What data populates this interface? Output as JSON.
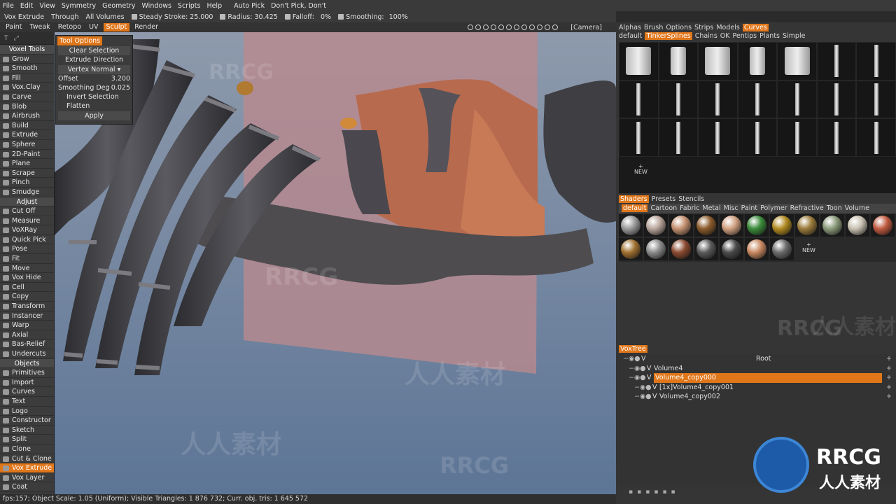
{
  "menu": {
    "items": [
      "File",
      "Edit",
      "View",
      "Symmetry",
      "Geometry",
      "Windows",
      "Scripts",
      "Help"
    ],
    "auto_pick": "Auto Pick",
    "dont_pick": "Don't  Pick,  Don't"
  },
  "toolstrip": {
    "tool": "Vox Extrude",
    "through": "Through",
    "all_volumes": "All  Volumes",
    "stroke": "Steady  Stroke: 25.000",
    "radius": "Radius: 30.425",
    "falloff": "Falloff:",
    "falloff_value": "0%",
    "smoothing": "Smoothing:",
    "smoothing_value": "100%"
  },
  "rooms": {
    "tabs": [
      "Paint",
      "Tweak",
      "Retopo",
      "UV",
      "Sculpt",
      "Render"
    ],
    "active": "Sculpt",
    "camera": "[Camera]"
  },
  "tool_options": {
    "title": "Tool  Options",
    "clear_selection": "Clear  Selection",
    "extrude_direction": "Extrude  Direction",
    "vertex_normal": "Vertex  Normal",
    "offset_label": "Offset",
    "offset_value": "3.200",
    "smoothing_label": "Smoothing  Deg",
    "smoothing_value": "0.025",
    "invert_selection": "Invert  Selection",
    "flatten": "Flatten",
    "apply": "Apply"
  },
  "left_panel": {
    "items": [
      {
        "label": "Voxel  Tools",
        "header": true
      },
      {
        "label": "Grow"
      },
      {
        "label": "Smooth"
      },
      {
        "label": "Fill"
      },
      {
        "label": "Vox.Clay"
      },
      {
        "label": "Carve"
      },
      {
        "label": "Blob"
      },
      {
        "label": "Airbrush"
      },
      {
        "label": "Build"
      },
      {
        "label": "Extrude"
      },
      {
        "label": "Sphere"
      },
      {
        "label": "2D-Paint"
      },
      {
        "label": "Plane"
      },
      {
        "label": "Scrape"
      },
      {
        "label": "Pinch"
      },
      {
        "label": "Smudge"
      },
      {
        "label": "Adjust",
        "header": true
      },
      {
        "label": "Cut  Off"
      },
      {
        "label": "Measure"
      },
      {
        "label": "VoXRay"
      },
      {
        "label": "Quick  Pick"
      },
      {
        "label": "Pose"
      },
      {
        "label": "Fit"
      },
      {
        "label": "Move"
      },
      {
        "label": "Vox  Hide"
      },
      {
        "label": "Cell"
      },
      {
        "label": "Copy"
      },
      {
        "label": "Transform"
      },
      {
        "label": "Instancer"
      },
      {
        "label": "Warp"
      },
      {
        "label": "Axial"
      },
      {
        "label": "Bas-Relief"
      },
      {
        "label": "Undercuts"
      },
      {
        "label": "Objects",
        "header": true
      },
      {
        "label": "Primitives"
      },
      {
        "label": "Import"
      },
      {
        "label": "Curves"
      },
      {
        "label": "Text"
      },
      {
        "label": "Logo"
      },
      {
        "label": "Constructor"
      },
      {
        "label": "Sketch"
      },
      {
        "label": "Split"
      },
      {
        "label": "Clone"
      },
      {
        "label": "Cut  &  Clone"
      },
      {
        "label": "Vox  Extrude",
        "selected": true
      },
      {
        "label": "Vox  Layer"
      },
      {
        "label": "Coat"
      }
    ]
  },
  "status_bar": "fps:157;    Object  Scale: 1.05  (Uniform);  Visible  Triangles: 1  876  732;  Curr.  obj.  tris: 1  645  572",
  "right": {
    "top_tabs": [
      "Alphas",
      "Brush",
      "Options",
      "Strips",
      "Models",
      "Curves"
    ],
    "top_active": "Curves",
    "curve_sets": [
      "default",
      "TinkerSplines",
      "Chains",
      "OK",
      "Pentips",
      "Plants",
      "Simple"
    ],
    "curve_active": "TinkerSplines",
    "new_label": "NEW",
    "shader_tabs": [
      "Shaders",
      "Presets",
      "Stencils"
    ],
    "shader_active": "Shaders",
    "shader_cats": [
      "default",
      "Cartoon",
      "Fabric",
      "Metal",
      "Misc",
      "Paint",
      "Polymer",
      "Refractive",
      "Toon",
      "Volume"
    ],
    "shader_cat_active": "default",
    "shader_colors": [
      "#9a9a9a",
      "#b8a49a",
      "#c49070",
      "#8a5a2a",
      "#d0a080",
      "#3a8a3a",
      "#b08a20",
      "#9a7a3a",
      "#8a9a7a",
      "#c8c0b0",
      "#c05a40",
      "#a07030",
      "#8a8a8a",
      "#8a4a30",
      "#5a5a5a",
      "#4a4a4a",
      "#c88860",
      "#6a6a6a"
    ],
    "voxtree_title": "VoxTree",
    "tree": [
      {
        "name": "Root",
        "indent": 0,
        "flag": "V"
      },
      {
        "name": "Volume4",
        "indent": 1,
        "flag": "V"
      },
      {
        "name": "Volume4_copy000",
        "indent": 1,
        "flag": "V",
        "selected": true
      },
      {
        "name": "[1x]Volume4_copy001",
        "indent": 2,
        "flag": "V"
      },
      {
        "name": "Volume4_copy002",
        "indent": 2,
        "flag": "V"
      }
    ]
  },
  "watermarks": {
    "brand": "RRCG",
    "cn": "人人素材"
  }
}
